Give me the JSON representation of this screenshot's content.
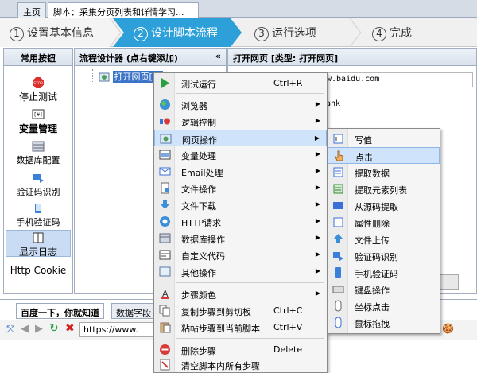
{
  "tabs": [
    {
      "label": "主页"
    },
    {
      "label": "脚本：采集分页列表和详情学习..."
    }
  ],
  "wizard": {
    "steps": [
      {
        "num": "1",
        "label": "设置基本信息"
      },
      {
        "num": "2",
        "label": "设计脚本流程"
      },
      {
        "num": "3",
        "label": "运行选项"
      },
      {
        "num": "4",
        "label": "完成"
      }
    ]
  },
  "left_panel": {
    "title": "常用按钮",
    "buttons": [
      {
        "label": "停止测试",
        "icon": "stop-icon"
      },
      {
        "label": "变量管理",
        "icon": "variable-icon"
      },
      {
        "label": "数据库配置",
        "icon": "database-icon"
      },
      {
        "label": "验证码识别",
        "icon": "captcha-icon"
      },
      {
        "label": "手机验证码",
        "icon": "phone-icon"
      },
      {
        "label": "显示日志",
        "icon": "log-icon"
      },
      {
        "label": "Http Cookie",
        "icon": ""
      }
    ]
  },
  "flow_panel": {
    "title": "流程设计器 (点右键添加)",
    "collapse": "«",
    "node": "打开网页[1]"
  },
  "prop_panel": {
    "title": "打开网页 [类型: 打开网页]",
    "url_fragment": "w.baidu.com",
    "blank_fragment": "ank"
  },
  "bottom": {
    "tabs": [
      {
        "label": "百度一下，你就知道"
      },
      {
        "label": "数据字段"
      }
    ],
    "url": "https://www."
  },
  "context_menu": {
    "items": [
      {
        "label": "测试运行",
        "shortcut": "Ctrl+R",
        "icon": "play-icon"
      },
      {
        "label": "浏览器",
        "icon": "globe-icon",
        "sub": true
      },
      {
        "label": "逻辑控制",
        "icon": "logic-icon",
        "sub": true
      },
      {
        "label": "网页操作",
        "icon": "webpage-icon",
        "sub": true
      },
      {
        "label": "变量处理",
        "icon": "variable-icon",
        "sub": true
      },
      {
        "label": "Email处理",
        "icon": "email-icon",
        "sub": true
      },
      {
        "label": "文件操作",
        "icon": "file-icon",
        "sub": true
      },
      {
        "label": "文件下载",
        "icon": "download-icon",
        "sub": true
      },
      {
        "label": "HTTP请求",
        "icon": "http-icon",
        "sub": true
      },
      {
        "label": "数据库操作",
        "icon": "database-icon",
        "sub": true
      },
      {
        "label": "自定义代码",
        "icon": "code-icon",
        "sub": true
      },
      {
        "label": "其他操作",
        "icon": "other-icon",
        "sub": true
      },
      {
        "label": "步骤颜色",
        "icon": "color-icon",
        "sub": true
      },
      {
        "label": "复制步骤到剪切板",
        "shortcut": "Ctrl+C",
        "icon": "copy-icon"
      },
      {
        "label": "粘帖步骤到当前脚本",
        "shortcut": "Ctrl+V",
        "icon": "paste-icon"
      },
      {
        "label": "删除步骤",
        "shortcut": "Delete",
        "icon": "delete-icon"
      },
      {
        "label": "清空脚本内所有步骤",
        "icon": "clear-icon"
      }
    ]
  },
  "submenu": {
    "items": [
      {
        "label": "写值",
        "icon": "write-icon"
      },
      {
        "label": "点击",
        "icon": "hand-icon"
      },
      {
        "label": "提取数据",
        "icon": "extract-icon"
      },
      {
        "label": "提取元素列表",
        "icon": "list-icon"
      },
      {
        "label": "从源码提取",
        "icon": "source-icon"
      },
      {
        "label": "属性删除",
        "icon": "attr-delete-icon"
      },
      {
        "label": "文件上传",
        "icon": "upload-icon"
      },
      {
        "label": "验证码识别",
        "icon": "captcha-icon"
      },
      {
        "label": "手机验证码",
        "icon": "phone-icon"
      },
      {
        "label": "键盘操作",
        "icon": "keyboard-icon"
      },
      {
        "label": "坐标点击",
        "icon": "mouse-icon"
      },
      {
        "label": "鼠标拖拽",
        "icon": "drag-icon"
      }
    ]
  },
  "colors": {
    "accent": "#2d9fd9",
    "highlight": "#cfe3fb"
  }
}
